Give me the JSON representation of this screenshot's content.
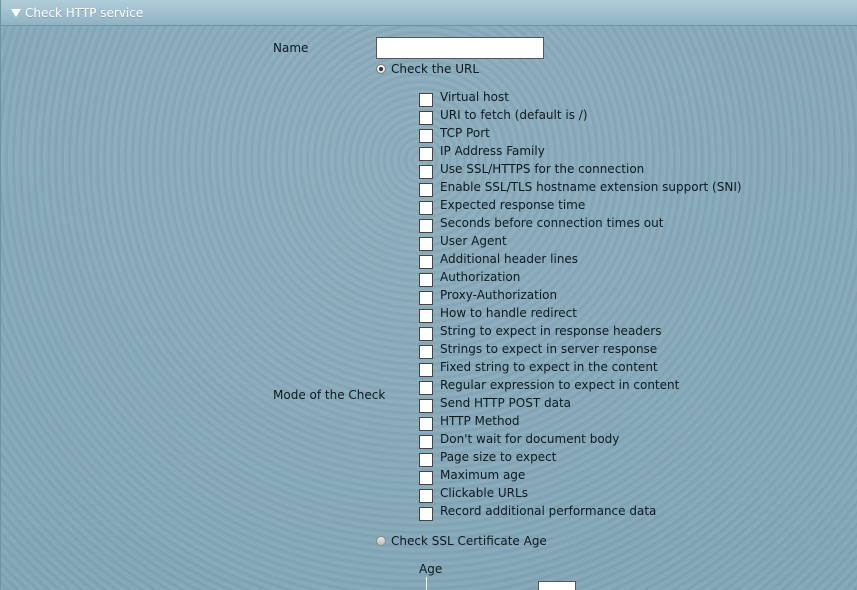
{
  "section": {
    "title": "Check HTTP service"
  },
  "form": {
    "name_label": "Name",
    "name_value": "",
    "check_url_label": "Check the URL",
    "mode_label": "Mode of the Check",
    "options": [
      {
        "label": "Virtual host",
        "checked": false
      },
      {
        "label": "URI to fetch (default is /)",
        "checked": false
      },
      {
        "label": "TCP Port",
        "checked": false
      },
      {
        "label": "IP Address Family",
        "checked": false
      },
      {
        "label": "Use SSL/HTTPS for the connection",
        "checked": false
      },
      {
        "label": "Enable SSL/TLS hostname extension support (SNI)",
        "checked": false
      },
      {
        "label": "Expected response time",
        "checked": false
      },
      {
        "label": "Seconds before connection times out",
        "checked": false
      },
      {
        "label": "User Agent",
        "checked": false
      },
      {
        "label": "Additional header lines",
        "checked": false
      },
      {
        "label": "Authorization",
        "checked": false
      },
      {
        "label": "Proxy-Authorization",
        "checked": false
      },
      {
        "label": "How to handle redirect",
        "checked": false
      },
      {
        "label": "String to expect in response headers",
        "checked": false
      },
      {
        "label": "Strings to expect in server response",
        "checked": false
      },
      {
        "label": "Fixed string to expect in the content",
        "checked": false
      },
      {
        "label": "Regular expression to expect in content",
        "checked": false
      },
      {
        "label": "Send HTTP POST data",
        "checked": false
      },
      {
        "label": "HTTP Method",
        "checked": false
      },
      {
        "label": "Don't wait for document body",
        "checked": false
      },
      {
        "label": "Page size to expect",
        "checked": false
      },
      {
        "label": "Maximum age",
        "checked": false
      },
      {
        "label": "Clickable URLs",
        "checked": false
      },
      {
        "label": "Record additional performance data",
        "checked": false
      }
    ],
    "check_ssl_label": "Check SSL Certificate Age",
    "age_label": "Age"
  }
}
